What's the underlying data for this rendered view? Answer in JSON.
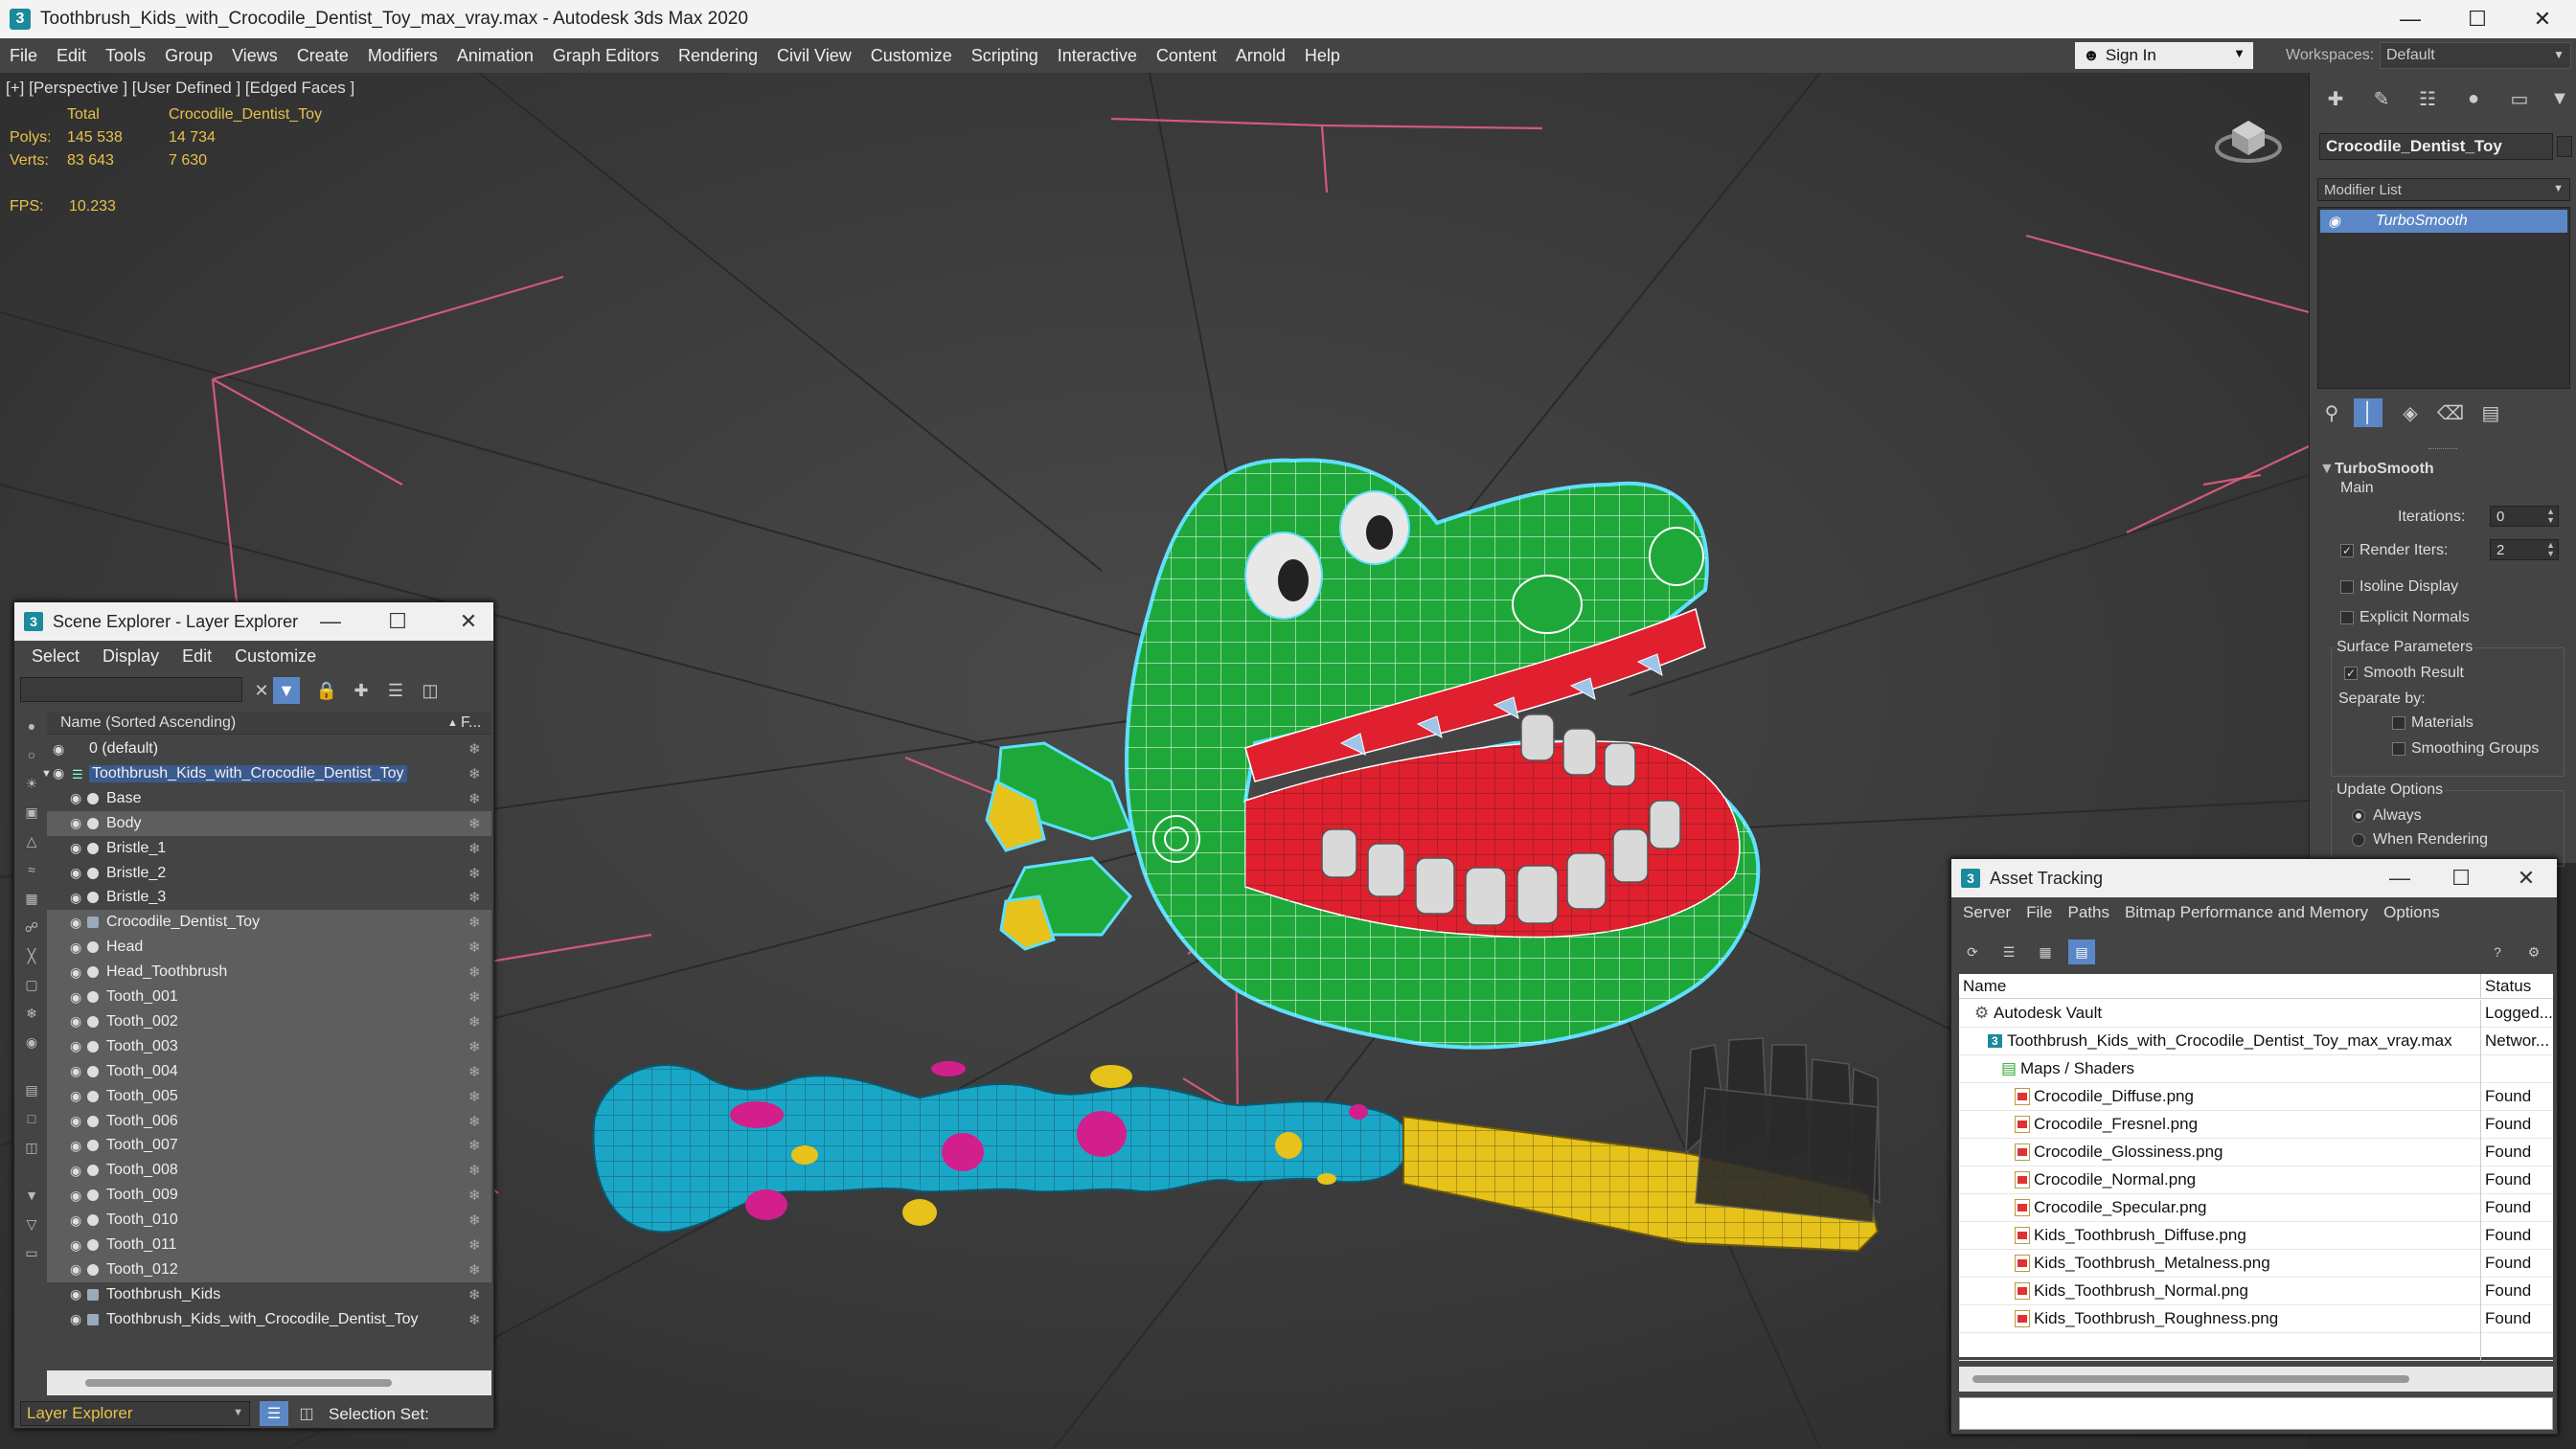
{
  "window": {
    "title": "Toothbrush_Kids_with_Crocodile_Dentist_Toy_max_vray.max - Autodesk 3ds Max 2020",
    "app_icon": "3"
  },
  "menu": [
    "File",
    "Edit",
    "Tools",
    "Group",
    "Views",
    "Create",
    "Modifiers",
    "Animation",
    "Graph Editors",
    "Rendering",
    "Civil View",
    "Customize",
    "Scripting",
    "Interactive",
    "Content",
    "Arnold",
    "Help"
  ],
  "signin": {
    "label": "Sign In"
  },
  "workspaces": {
    "label": "Workspaces:",
    "value": "Default"
  },
  "viewport": {
    "label": "[+] [Perspective ] [User Defined ] [Edged Faces ]",
    "stats": {
      "total_label": "Total",
      "object_label": "Crocodile_Dentist_Toy",
      "polys_label": "Polys:",
      "polys_total": "145 538",
      "polys_object": "14 734",
      "verts_label": "Verts:",
      "verts_total": "83 643",
      "verts_object": "7 630",
      "fps_label": "FPS:",
      "fps_value": "10.233"
    }
  },
  "command_panel": {
    "object_name": "Crocodile_Dentist_Toy",
    "modifier_list": "Modifier List",
    "stack": [
      "TurboSmooth"
    ],
    "turbosmooth": {
      "title": "TurboSmooth",
      "main": "Main",
      "iterations_label": "Iterations:",
      "iterations": "0",
      "render_iters_label": "Render Iters:",
      "render_iters": "2",
      "isoline": "Isoline Display",
      "explicit_normals": "Explicit Normals",
      "surface_params": "Surface Parameters",
      "smooth_result": "Smooth Result",
      "separate_by": "Separate by:",
      "materials": "Materials",
      "smoothing_groups": "Smoothing Groups",
      "update_options": "Update Options",
      "always": "Always",
      "when_rendering": "When Rendering"
    }
  },
  "scene_explorer": {
    "title": "Scene Explorer - Layer Explorer",
    "menu": [
      "Select",
      "Display",
      "Edit",
      "Customize"
    ],
    "column_name": "Name (Sorted Ascending)",
    "column_freeze": "F...",
    "rows": [
      {
        "name": "0 (default)",
        "level": 0,
        "type": "layer"
      },
      {
        "name": "Toothbrush_Kids_with_Crocodile_Dentist_Toy",
        "level": 0,
        "type": "layer-active"
      },
      {
        "name": "Base",
        "level": 1,
        "type": "object"
      },
      {
        "name": "Body",
        "level": 1,
        "type": "object",
        "selected": true
      },
      {
        "name": "Bristle_1",
        "level": 1,
        "type": "object"
      },
      {
        "name": "Bristle_2",
        "level": 1,
        "type": "object"
      },
      {
        "name": "Bristle_3",
        "level": 1,
        "type": "object"
      },
      {
        "name": "Crocodile_Dentist_Toy",
        "level": 1,
        "type": "group",
        "selected": true
      },
      {
        "name": "Head",
        "level": 1,
        "type": "object",
        "selected": true
      },
      {
        "name": "Head_Toothbrush",
        "level": 1,
        "type": "object",
        "selected": true
      },
      {
        "name": "Tooth_001",
        "level": 1,
        "type": "object",
        "selected": true
      },
      {
        "name": "Tooth_002",
        "level": 1,
        "type": "object",
        "selected": true
      },
      {
        "name": "Tooth_003",
        "level": 1,
        "type": "object",
        "selected": true
      },
      {
        "name": "Tooth_004",
        "level": 1,
        "type": "object",
        "selected": true
      },
      {
        "name": "Tooth_005",
        "level": 1,
        "type": "object",
        "selected": true
      },
      {
        "name": "Tooth_006",
        "level": 1,
        "type": "object",
        "selected": true
      },
      {
        "name": "Tooth_007",
        "level": 1,
        "type": "object",
        "selected": true
      },
      {
        "name": "Tooth_008",
        "level": 1,
        "type": "object",
        "selected": true
      },
      {
        "name": "Tooth_009",
        "level": 1,
        "type": "object",
        "selected": true
      },
      {
        "name": "Tooth_010",
        "level": 1,
        "type": "object",
        "selected": true
      },
      {
        "name": "Tooth_011",
        "level": 1,
        "type": "object",
        "selected": true
      },
      {
        "name": "Tooth_012",
        "level": 1,
        "type": "object",
        "selected": true
      },
      {
        "name": "Toothbrush_Kids",
        "level": 1,
        "type": "group"
      },
      {
        "name": "Toothbrush_Kids_with_Crocodile_Dentist_Toy",
        "level": 1,
        "type": "group"
      }
    ],
    "bottom_mode": "Layer Explorer",
    "selection_set": "Selection Set:"
  },
  "asset_tracking": {
    "title": "Asset Tracking",
    "menu": [
      "Server",
      "File",
      "Paths",
      "Bitmap Performance and Memory",
      "Options"
    ],
    "col_name": "Name",
    "col_status": "Status",
    "rows": [
      {
        "name": "Autodesk Vault",
        "status": "Logged...",
        "level": 0
      },
      {
        "name": "Toothbrush_Kids_with_Crocodile_Dentist_Toy_max_vray.max",
        "status": "Networ...",
        "level": 1
      },
      {
        "name": "Maps / Shaders",
        "status": "",
        "level": 2
      },
      {
        "name": "Crocodile_Diffuse.png",
        "status": "Found",
        "level": 3
      },
      {
        "name": "Crocodile_Fresnel.png",
        "status": "Found",
        "level": 3
      },
      {
        "name": "Crocodile_Glossiness.png",
        "status": "Found",
        "level": 3
      },
      {
        "name": "Crocodile_Normal.png",
        "status": "Found",
        "level": 3
      },
      {
        "name": "Crocodile_Specular.png",
        "status": "Found",
        "level": 3
      },
      {
        "name": "Kids_Toothbrush_Diffuse.png",
        "status": "Found",
        "level": 3
      },
      {
        "name": "Kids_Toothbrush_Metalness.png",
        "status": "Found",
        "level": 3
      },
      {
        "name": "Kids_Toothbrush_Normal.png",
        "status": "Found",
        "level": 3
      },
      {
        "name": "Kids_Toothbrush_Roughness.png",
        "status": "Found",
        "level": 3
      }
    ]
  },
  "colors": {
    "selection_highlight": "#5b87c6",
    "stats_text": "#e8c24a",
    "crocodile_green": "#1fa83a",
    "mouth_red": "#e0202e",
    "brush_cyan": "#1aa7c7",
    "brush_yellow": "#e6c21a",
    "spot_magenta": "#d21f8c"
  }
}
